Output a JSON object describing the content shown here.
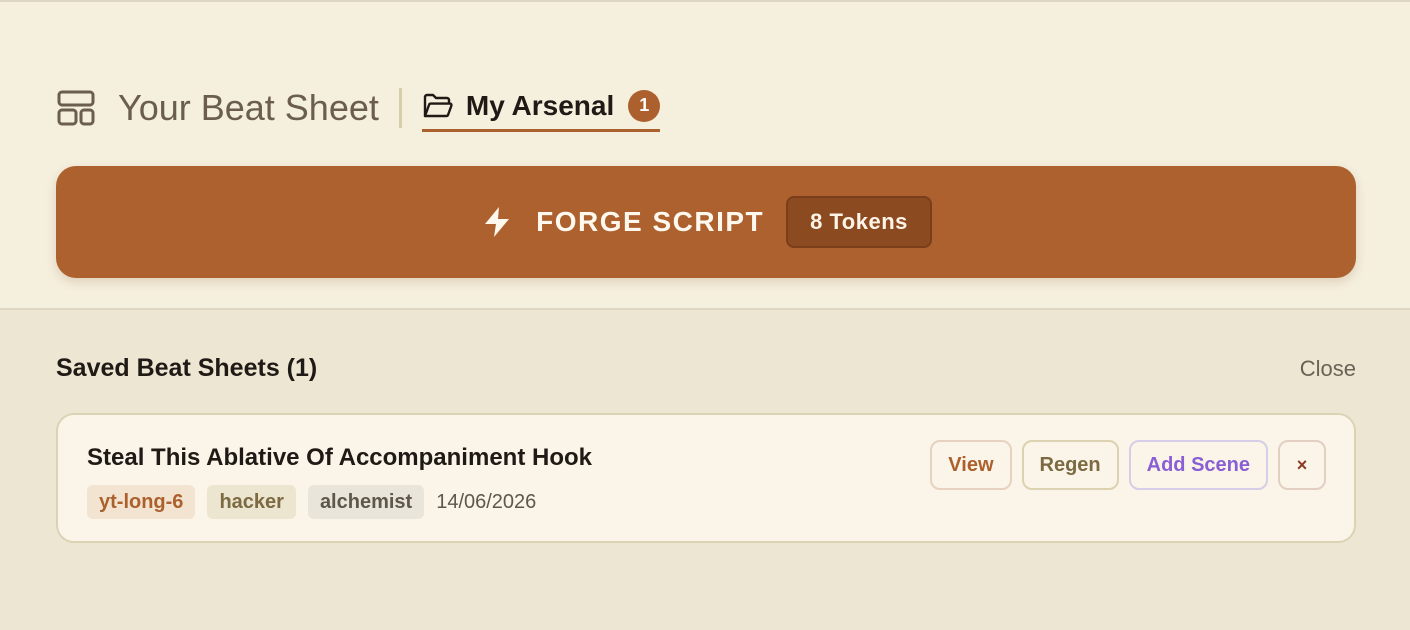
{
  "tabs": {
    "beat_sheet": "Your Beat Sheet",
    "arsenal": "My Arsenal",
    "arsenal_count": "1"
  },
  "forge": {
    "label": "FORGE SCRIPT",
    "tokens": "8 Tokens"
  },
  "saved": {
    "title": "Saved Beat Sheets (1)",
    "close_label": "Close",
    "items": [
      {
        "title": "Steal This Ablative Of Accompaniment Hook",
        "tags": [
          "yt-long-6",
          "hacker",
          "alchemist"
        ],
        "date": "14/06/2026",
        "actions": {
          "view": "View",
          "regen": "Regen",
          "add_scene": "Add Scene",
          "delete": "×"
        }
      }
    ]
  },
  "colors": {
    "accent": "#ac612e",
    "panel_bg": "#f5efdd",
    "page_bg": "#ede6d3",
    "add_scene": "#8a5ed4"
  },
  "icons": {
    "beat_sheet": "layout-icon",
    "arsenal": "folder-open-icon",
    "forge": "lightning-bolt-icon"
  }
}
